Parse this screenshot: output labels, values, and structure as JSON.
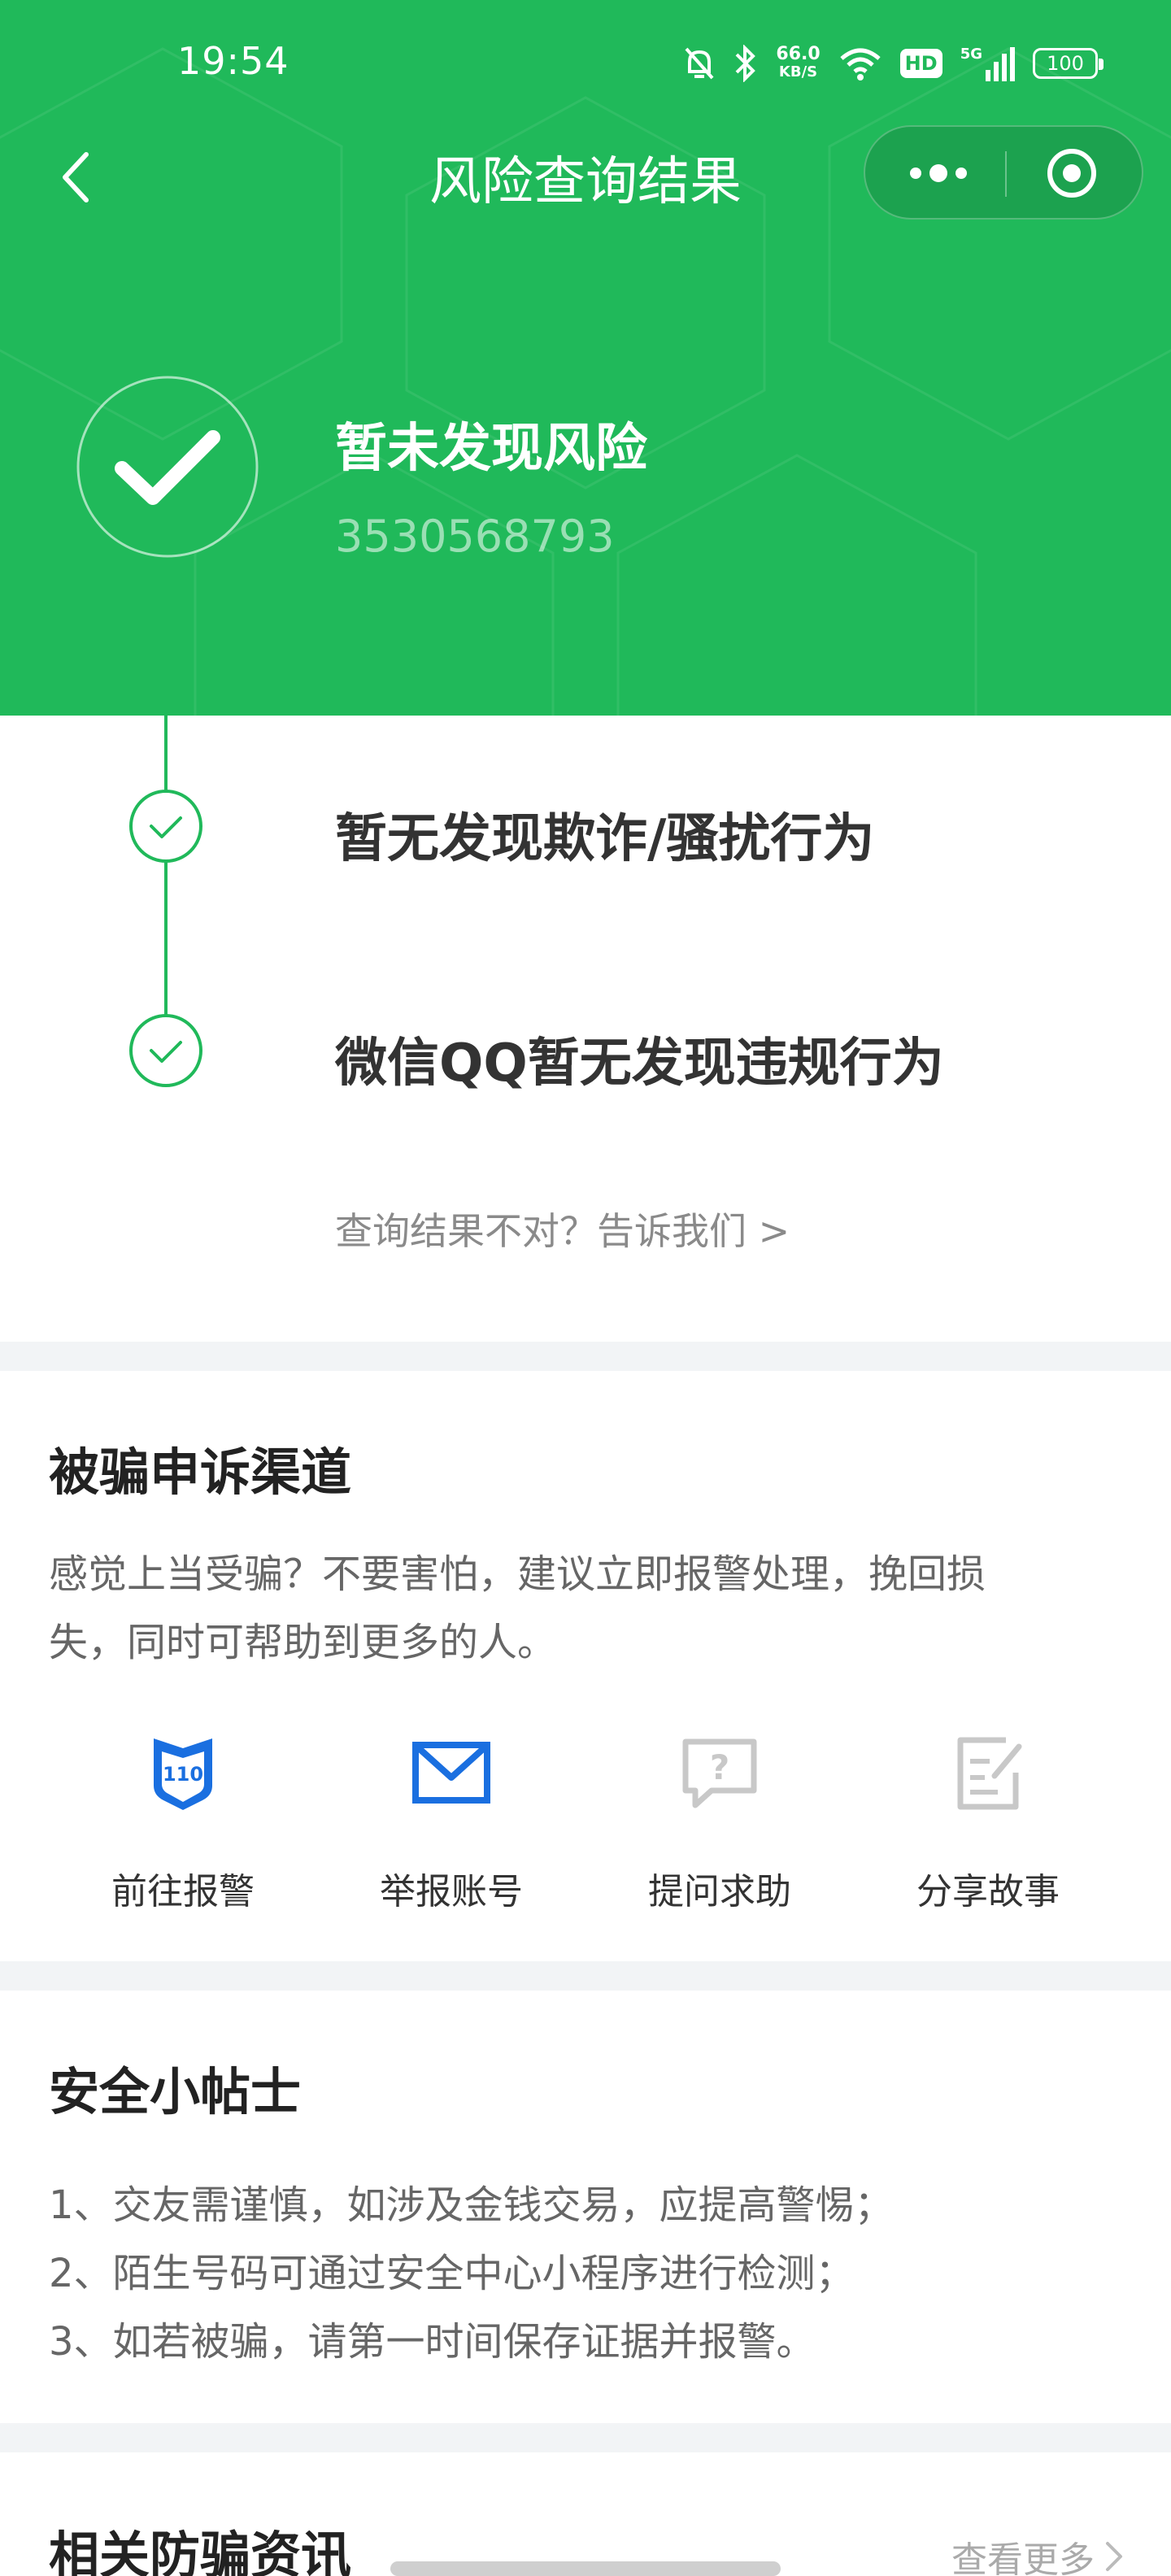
{
  "status_bar": {
    "time": "19:54",
    "speed_value": "66.0",
    "speed_unit": "KB/S",
    "hd_label": "HD",
    "network_label": "5G",
    "battery": "100"
  },
  "navbar": {
    "title": "风险查询结果",
    "back_icon": "chevron-left-icon",
    "more_icon": "more-dots-icon",
    "close_icon": "target-circle-icon"
  },
  "result": {
    "title": "暂未发现风险",
    "account_id": "3530568793",
    "icon": "check-icon"
  },
  "checks": [
    {
      "label": "暂无发现欺诈/骚扰行为",
      "icon": "check-circle-icon"
    },
    {
      "label": "微信QQ暂无发现违规行为",
      "icon": "check-circle-icon"
    }
  ],
  "feedback_link": "查询结果不对？告诉我们 >",
  "appeal": {
    "title": "被骗申诉渠道",
    "desc_line1": "感觉上当受骗？不要害怕，建议立即报警处理，挽回损",
    "desc_line2": "失，同时可帮助到更多的人。",
    "actions": [
      {
        "label": "前往报警",
        "icon": "police-110-icon",
        "badge": "110",
        "color": "#1a6fe0"
      },
      {
        "label": "举报账号",
        "icon": "mail-icon",
        "color": "#1a6fe0"
      },
      {
        "label": "提问求助",
        "icon": "question-chat-icon",
        "color": "#c8c8c8"
      },
      {
        "label": "分享故事",
        "icon": "edit-note-icon",
        "color": "#c8c8c8"
      }
    ]
  },
  "tips": {
    "title": "安全小帖士",
    "items": [
      "1、交友需谨慎，如涉及金钱交易，应提高警惕；",
      "2、陌生号码可通过安全中心小程序进行检测；",
      "3、如若被骗，请第一时间保存证据并报警。"
    ]
  },
  "news": {
    "title": "相关防骗资讯",
    "view_more": "查看更多",
    "view_more_icon": "chevron-right-icon"
  },
  "colors": {
    "brand_green": "#20b95a",
    "accent_blue": "#1a6fe0",
    "muted_gray": "#c8c8c8"
  }
}
